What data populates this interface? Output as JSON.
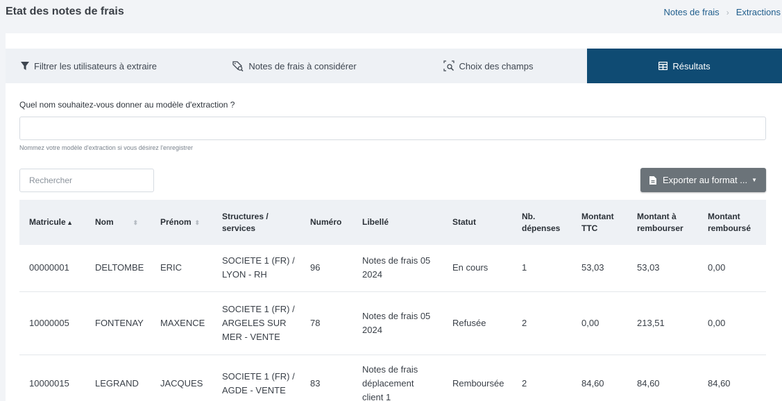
{
  "page_title": "Etat des notes de frais",
  "breadcrumb": {
    "items": [
      "Notes de frais",
      "Extractions"
    ]
  },
  "tabs": [
    {
      "label": "Filtrer les utilisateurs à extraire",
      "icon": "filter-icon",
      "active": false
    },
    {
      "label": "Notes de frais à considérer",
      "icon": "tag-search-icon",
      "active": false
    },
    {
      "label": "Choix des champs",
      "icon": "field-search-icon",
      "active": false
    },
    {
      "label": "Résultats",
      "icon": "table-icon",
      "active": true
    }
  ],
  "form": {
    "label": "Quel nom souhaitez-vous donner au modèle d'extraction ?",
    "value": "",
    "help": "Nommez votre modèle d'extraction si vous désirez l'enregistrer"
  },
  "search": {
    "placeholder": "Rechercher"
  },
  "export": {
    "label": "Exporter au format ...",
    "icon": "file-icon"
  },
  "table": {
    "columns": [
      "Matricule",
      "Nom",
      "Prénom",
      "Structures / services",
      "Numéro",
      "Libellé",
      "Statut",
      "Nb. dépenses",
      "Montant TTC",
      "Montant à rembourser",
      "Montant remboursé"
    ],
    "rows": [
      [
        "00000001",
        "DELTOMBE",
        "ERIC",
        "SOCIETE 1 (FR) / LYON - RH",
        "96",
        "Notes de frais 05 2024",
        "En cours",
        "1",
        "53,03",
        "53,03",
        "0,00"
      ],
      [
        "10000005",
        "FONTENAY",
        "MAXENCE",
        "SOCIETE 1 (FR) / ARGELES SUR MER - VENTE",
        "78",
        "Notes de frais 05 2024",
        "Refusée",
        "2",
        "0,00",
        "213,51",
        "0,00"
      ],
      [
        "10000015",
        "LEGRAND",
        "JACQUES",
        "SOCIETE 1 (FR) / AGDE - VENTE",
        "83",
        "Notes de frais déplacement client 1",
        "Remboursée",
        "2",
        "84,60",
        "84,60",
        "84,60"
      ]
    ]
  }
}
